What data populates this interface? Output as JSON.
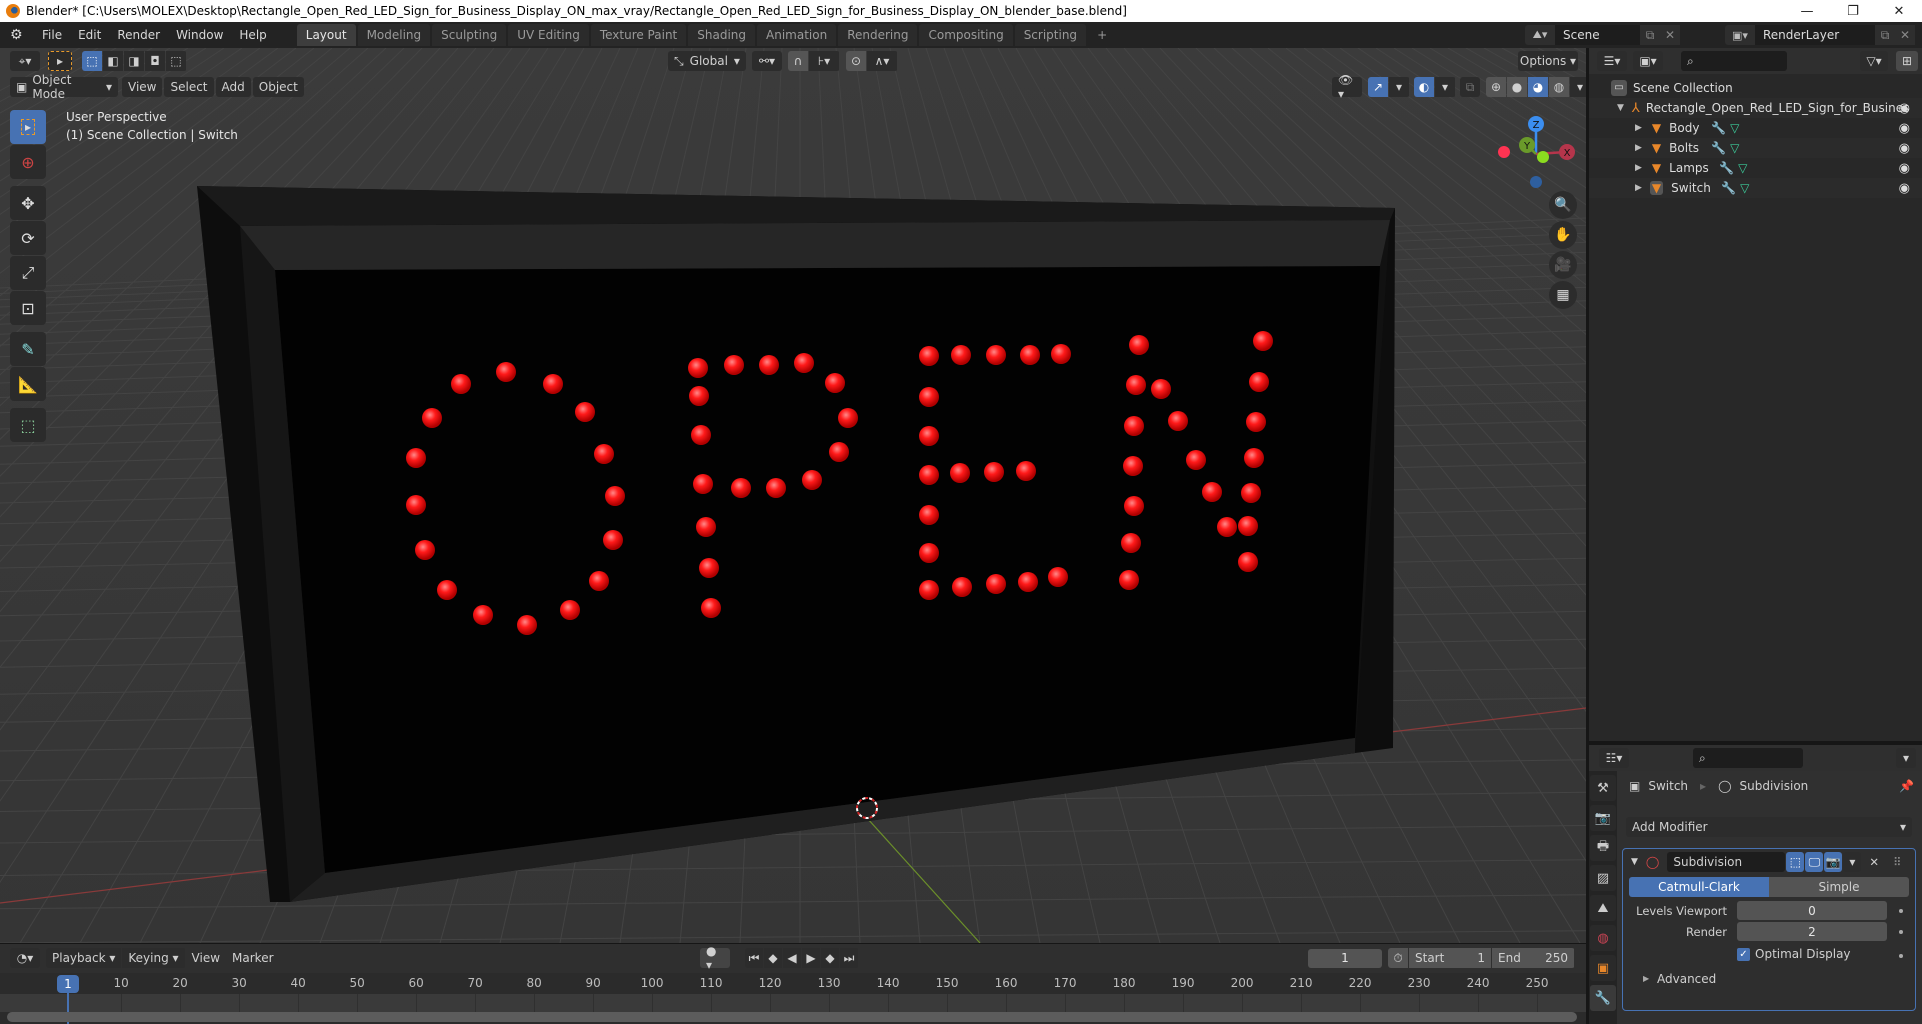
{
  "window": {
    "title": "Blender* [C:\\Users\\MOLEX\\Desktop\\Rectangle_Open_Red_LED_Sign_for_Business_Display_ON_max_vray/Rectangle_Open_Red_LED_Sign_for_Business_Display_ON_blender_base.blend]",
    "minimize": "—",
    "maximize": "❐",
    "close": "✕"
  },
  "menubar": {
    "items": [
      "File",
      "Edit",
      "Render",
      "Window",
      "Help"
    ],
    "workspace_tabs": [
      "Layout",
      "Modeling",
      "Sculpting",
      "UV Editing",
      "Texture Paint",
      "Shading",
      "Animation",
      "Rendering",
      "Compositing",
      "Scripting"
    ],
    "active_tab": "Layout",
    "add_tab": "+",
    "scene": "Scene",
    "view_layer": "RenderLayer"
  },
  "viewport": {
    "tool_header": {
      "orientation": "Global",
      "options": "Options"
    },
    "header": {
      "mode": "Object Mode",
      "menus": [
        "View",
        "Select",
        "Add",
        "Object"
      ]
    },
    "info": {
      "line1": "User Perspective",
      "line2": "(1) Scene Collection | Switch"
    },
    "gizmo": {
      "x": "X",
      "y": "Y",
      "z": "Z"
    },
    "sign_text": "OPEN",
    "led_color": "#ff1a1a"
  },
  "timeline": {
    "menus": [
      "Playback",
      "Keying",
      "View",
      "Marker"
    ],
    "current_frame": "1",
    "frame_field": "1",
    "start_label": "Start",
    "start": "1",
    "end_label": "End",
    "end": "250",
    "ticks": [
      "10",
      "20",
      "30",
      "40",
      "50",
      "60",
      "70",
      "80",
      "90",
      "100",
      "110",
      "120",
      "130",
      "140",
      "150",
      "160",
      "170",
      "180",
      "190",
      "200",
      "210",
      "220",
      "230",
      "240",
      "250"
    ]
  },
  "outliner": {
    "scene_collection": "Scene Collection",
    "root": "Rectangle_Open_Red_LED_Sign_for_Busines",
    "children": [
      "Body",
      "Bolts",
      "Lamps",
      "Switch"
    ]
  },
  "properties": {
    "breadcrumb_object": "Switch",
    "breadcrumb_modifier": "Subdivision",
    "add_modifier": "Add Modifier",
    "modifier_name": "Subdivision",
    "type_catmull": "Catmull-Clark",
    "type_simple": "Simple",
    "levels_viewport_label": "Levels Viewport",
    "levels_viewport": "0",
    "render_label": "Render",
    "render": "2",
    "optimal_display": "Optimal Display",
    "optimal_display_checked": true,
    "advanced": "Advanced"
  },
  "colors": {
    "accent": "#4772b3",
    "led": "#ff1a1a",
    "object_orange": "#e8872a"
  }
}
